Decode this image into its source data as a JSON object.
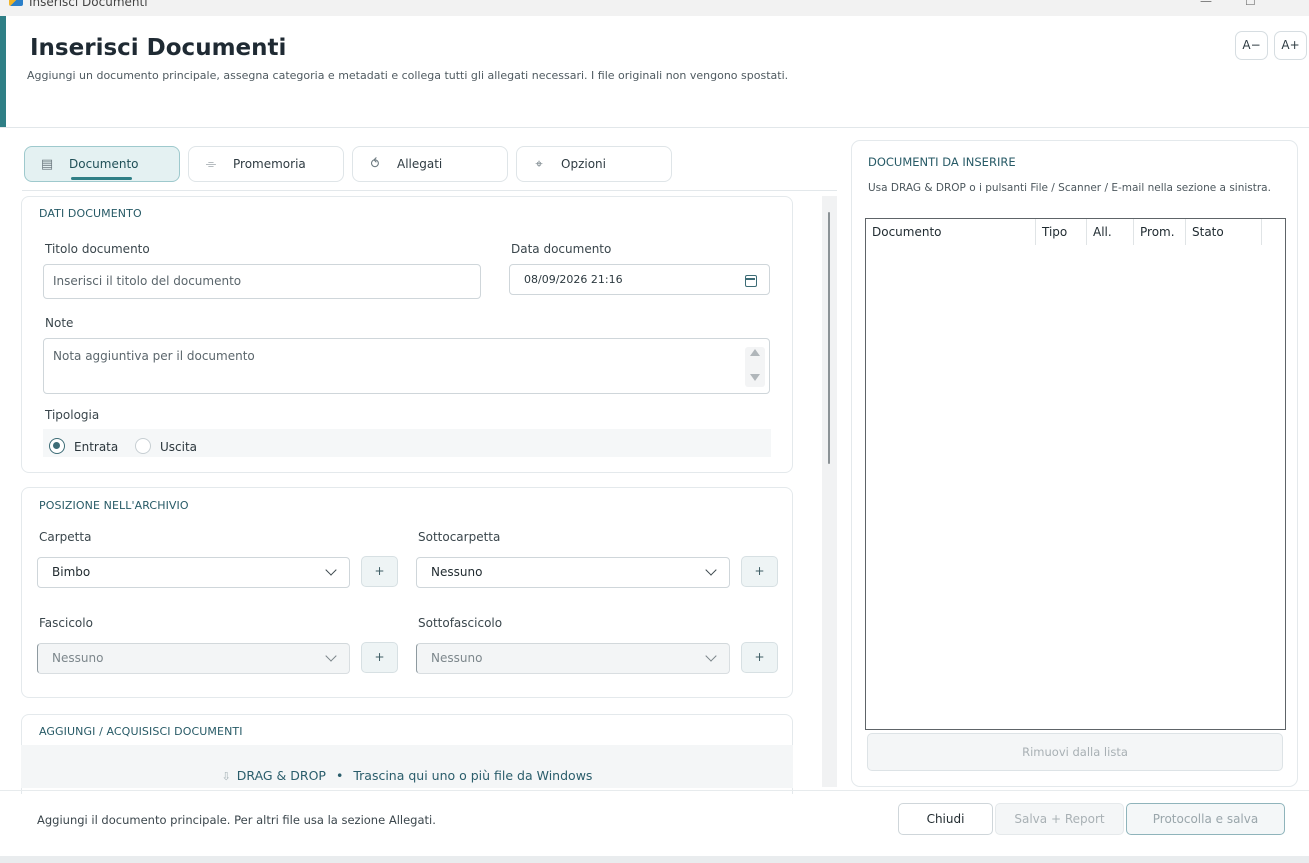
{
  "window": {
    "title": "Inserisci Documenti",
    "minimize": "—",
    "maximize": "☐"
  },
  "header": {
    "title": "Inserisci Documenti",
    "subtitle": "Aggiungi un documento principale, assegna categoria e metadati e collega tutti gli allegati necessari. I file originali non vengono spostati.",
    "font_decrease": "A−",
    "font_increase": "A+"
  },
  "tabs": [
    {
      "label": "Documento",
      "icon": "document-icon",
      "glyph": "▤",
      "active": true
    },
    {
      "label": "Promemoria",
      "icon": "reminder-icon",
      "glyph": "⌯",
      "active": false
    },
    {
      "label": "Allegati",
      "icon": "attachment-icon",
      "glyph": "⥀",
      "active": false
    },
    {
      "label": "Opzioni",
      "icon": "options-icon",
      "glyph": "⌖",
      "active": false
    }
  ],
  "dati_documento": {
    "section_title": "DATI DOCUMENTO",
    "title_label": "Titolo documento",
    "title_placeholder": "Inserisci il titolo del documento",
    "date_label": "Data documento",
    "date_value": "08/09/2026 21:16",
    "note_label": "Note",
    "note_placeholder": "Nota aggiuntiva per il documento",
    "tipologia_label": "Tipologia",
    "tipologia_options": [
      {
        "label": "Entrata",
        "checked": true
      },
      {
        "label": "Uscita",
        "checked": false
      }
    ]
  },
  "posizione": {
    "section_title": "POSIZIONE NELL'ARCHIVIO",
    "carpetta_label": "Carpetta",
    "carpetta_value": "Bimbo",
    "sottocarpetta_label": "Sottocarpetta",
    "sottocarpetta_value": "Nessuno",
    "fascicolo_label": "Fascicolo",
    "fascicolo_value": "Nessuno",
    "sottofascicolo_label": "Sottofascicolo",
    "sottofascicolo_value": "Nessuno",
    "add_label": "+"
  },
  "acquisisci": {
    "section_title": "AGGIUNGI / ACQUISISCI DOCUMENTI",
    "drag_title": "DRAG & DROP",
    "separator": "•",
    "drag_hint": "Trascina qui uno o più file da Windows"
  },
  "documenti_da_inserire": {
    "title": "DOCUMENTI DA INSERIRE",
    "subtitle": "Usa DRAG & DROP o i pulsanti File / Scanner / E-mail nella sezione a sinistra.",
    "columns": [
      "Documento",
      "Tipo",
      "All.",
      "Prom.",
      "Stato"
    ],
    "rows": [],
    "remove_button": "Rimuovi dalla lista"
  },
  "footer": {
    "status": "Aggiungi il documento principale. Per altri file usa la sezione Allegati.",
    "close_button": "Chiudi",
    "save_report_button": "Salva + Report",
    "protocol_button": "Protocolla e salva"
  },
  "colors": {
    "accent": "#2f7f86",
    "section_title": "#275a66"
  }
}
